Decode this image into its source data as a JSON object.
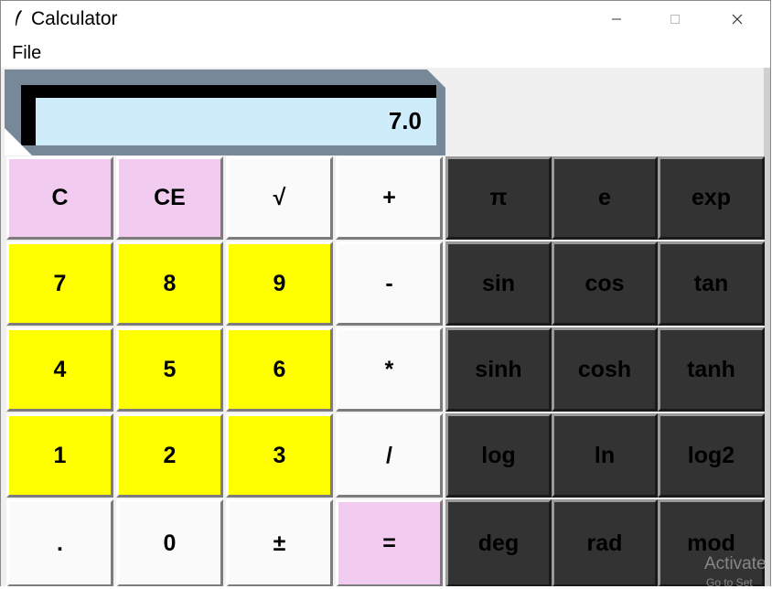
{
  "window": {
    "title": "Calculator"
  },
  "window_controls": {
    "minimize": "–",
    "maximize": "☐",
    "close": "✕"
  },
  "menu": {
    "file": "File"
  },
  "display": {
    "value": "7.0",
    "background": "#cfecfb",
    "frame": "#778899"
  },
  "colors": {
    "pink": "#f2cbf0",
    "yellow": "#ffff00",
    "white": "#fafafa",
    "dark": "#333333"
  },
  "buttons": [
    [
      {
        "label": "C",
        "color": "pink"
      },
      {
        "label": "CE",
        "color": "pink"
      },
      {
        "label": "√",
        "color": "white"
      },
      {
        "label": "+",
        "color": "white"
      },
      {
        "label": "π",
        "color": "dark"
      },
      {
        "label": "e",
        "color": "dark"
      },
      {
        "label": "exp",
        "color": "dark"
      }
    ],
    [
      {
        "label": "7",
        "color": "yellow"
      },
      {
        "label": "8",
        "color": "yellow"
      },
      {
        "label": "9",
        "color": "yellow"
      },
      {
        "label": "-",
        "color": "white"
      },
      {
        "label": "sin",
        "color": "dark"
      },
      {
        "label": "cos",
        "color": "dark"
      },
      {
        "label": "tan",
        "color": "dark"
      }
    ],
    [
      {
        "label": "4",
        "color": "yellow"
      },
      {
        "label": "5",
        "color": "yellow"
      },
      {
        "label": "6",
        "color": "yellow"
      },
      {
        "label": "*",
        "color": "white"
      },
      {
        "label": "sinh",
        "color": "dark"
      },
      {
        "label": "cosh",
        "color": "dark"
      },
      {
        "label": "tanh",
        "color": "dark"
      }
    ],
    [
      {
        "label": "1",
        "color": "yellow"
      },
      {
        "label": "2",
        "color": "yellow"
      },
      {
        "label": "3",
        "color": "yellow"
      },
      {
        "label": "/",
        "color": "white"
      },
      {
        "label": "log",
        "color": "dark"
      },
      {
        "label": "ln",
        "color": "dark"
      },
      {
        "label": "log2",
        "color": "dark"
      }
    ],
    [
      {
        "label": ".",
        "color": "white"
      },
      {
        "label": "0",
        "color": "white"
      },
      {
        "label": "±",
        "color": "white"
      },
      {
        "label": "=",
        "color": "pink"
      },
      {
        "label": "deg",
        "color": "dark"
      },
      {
        "label": "rad",
        "color": "dark"
      },
      {
        "label": "mod",
        "color": "dark"
      }
    ]
  ],
  "overlay": {
    "line1": "Activate",
    "line2": "Go to Set"
  }
}
